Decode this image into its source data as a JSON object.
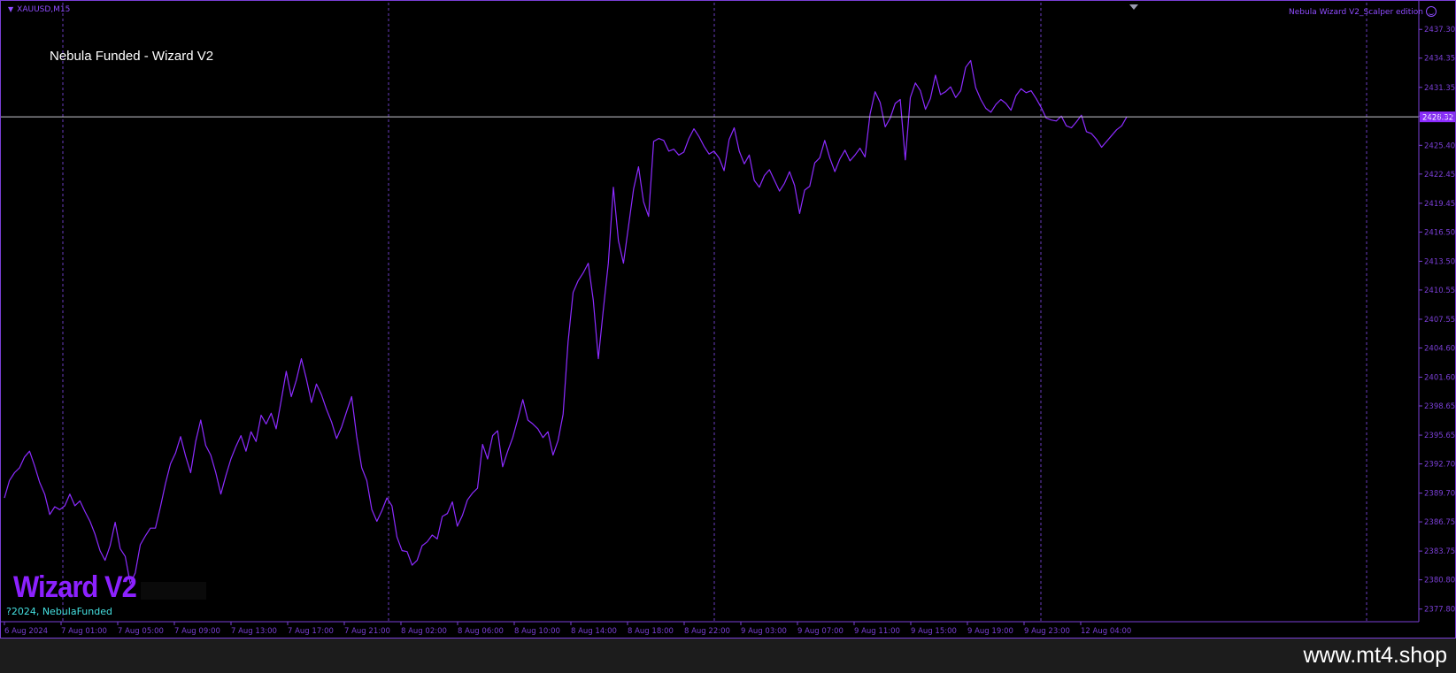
{
  "window": {
    "symbol": "XAUUSD,M15",
    "indicator_label": "Nebula Wizard V2_Scalper edition",
    "overlay_title": "Nebula Funded - Wizard V2",
    "logo_text": "Wizard V2",
    "copyright": "?2024, NebulaFunded",
    "current_price": "2428.32"
  },
  "watermark": "www.mt4.shop",
  "colors": {
    "background": "#000000",
    "line": "#8c2bff",
    "axis": "#7a3fd6",
    "separator": "#6a3bbf",
    "price_line": "#c8c8d0",
    "price_label_bg": "#8c2bff",
    "copyright": "#45e0e0"
  },
  "chart_data": {
    "type": "line",
    "symbol": "XAUUSD",
    "timeframe": "M15",
    "ylim": [
      2376.5,
      2439.5
    ],
    "y_ticks": [
      "2437.30",
      "2434.35",
      "2431.35",
      "2428.40",
      "2425.40",
      "2422.45",
      "2419.45",
      "2416.50",
      "2413.50",
      "2410.55",
      "2407.55",
      "2404.60",
      "2401.60",
      "2398.65",
      "2395.65",
      "2392.70",
      "2389.70",
      "2386.75",
      "2383.75",
      "2380.80",
      "2377.80"
    ],
    "x_ticks": [
      "6 Aug 2024",
      "7 Aug 01:00",
      "7 Aug 05:00",
      "7 Aug 09:00",
      "7 Aug 13:00",
      "7 Aug 17:00",
      "7 Aug 21:00",
      "8 Aug 02:00",
      "8 Aug 06:00",
      "8 Aug 10:00",
      "8 Aug 14:00",
      "8 Aug 18:00",
      "8 Aug 22:00",
      "9 Aug 03:00",
      "9 Aug 07:00",
      "9 Aug 11:00",
      "9 Aug 15:00",
      "9 Aug 19:00",
      "9 Aug 23:00",
      "12 Aug 04:00"
    ],
    "current_price": 2428.32,
    "series": [
      {
        "values": [
          2389.2,
          2391.0,
          2391.8,
          2392.3,
          2393.4,
          2394.0,
          2392.5,
          2390.8,
          2389.6,
          2387.5,
          2388.3,
          2388.0,
          2388.4,
          2389.6,
          2388.4,
          2388.9,
          2387.8,
          2386.8,
          2385.5,
          2383.8,
          2382.8,
          2384.3,
          2386.7,
          2384.0,
          2383.2,
          2380.4,
          2381.5,
          2384.4,
          2385.3,
          2386.1,
          2386.1,
          2388.3,
          2390.7,
          2392.7,
          2393.8,
          2395.5,
          2393.5,
          2391.8,
          2395.0,
          2397.2,
          2394.6,
          2393.6,
          2391.8,
          2389.6,
          2391.5,
          2393.2,
          2394.5,
          2395.6,
          2394.0,
          2396.0,
          2395.0,
          2397.7,
          2396.8,
          2397.9,
          2396.3,
          2399.2,
          2402.2,
          2399.6,
          2401.3,
          2403.5,
          2401.4,
          2399.0,
          2400.9,
          2399.8,
          2398.3,
          2397.0,
          2395.3,
          2396.5,
          2398.1,
          2399.6,
          2395.5,
          2392.3,
          2391.0,
          2388.0,
          2386.8,
          2387.9,
          2389.2,
          2388.4,
          2385.2,
          2383.8,
          2383.7,
          2382.3,
          2382.8,
          2384.3,
          2384.7,
          2385.4,
          2385.0,
          2387.3,
          2387.6,
          2388.8,
          2386.3,
          2387.4,
          2389.0,
          2389.7,
          2390.2,
          2394.7,
          2393.2,
          2395.6,
          2396.1,
          2392.4,
          2394.0,
          2395.4,
          2397.3,
          2399.3,
          2397.2,
          2396.8,
          2396.3,
          2395.4,
          2396.0,
          2393.6,
          2395.1,
          2397.8,
          2405.2,
          2410.3,
          2411.5,
          2412.3,
          2413.3,
          2409.5,
          2403.5,
          2408.5,
          2413.3,
          2421.1,
          2415.6,
          2413.3,
          2417.1,
          2420.9,
          2423.2,
          2419.6,
          2418.1,
          2425.8,
          2426.1,
          2425.9,
          2424.8,
          2425.0,
          2424.4,
          2424.7,
          2426.1,
          2427.1,
          2426.3,
          2425.3,
          2424.5,
          2424.8,
          2424.1,
          2422.8,
          2426.0,
          2427.2,
          2424.8,
          2423.5,
          2424.4,
          2421.8,
          2421.1,
          2422.3,
          2422.9,
          2421.8,
          2420.7,
          2421.5,
          2422.7,
          2421.3,
          2418.4,
          2420.8,
          2421.2,
          2423.6,
          2424.1,
          2425.9,
          2424.1,
          2422.7,
          2424.0,
          2424.9,
          2423.8,
          2424.4,
          2425.1,
          2424.2,
          2428.6,
          2430.9,
          2429.8,
          2427.3,
          2428.2,
          2429.7,
          2430.1,
          2423.9,
          2430.3,
          2431.8,
          2431.0,
          2429.1,
          2430.2,
          2432.6,
          2430.6,
          2430.9,
          2431.4,
          2430.3,
          2431.0,
          2433.4,
          2434.1,
          2431.3,
          2430.1,
          2429.2,
          2428.8,
          2429.6,
          2430.1,
          2429.7,
          2429.0,
          2430.5,
          2431.2,
          2430.8,
          2431.0,
          2430.2,
          2429.3,
          2428.2,
          2428.0,
          2427.9,
          2428.4,
          2427.4,
          2427.2,
          2427.8,
          2428.5,
          2426.8,
          2426.6,
          2426.0,
          2425.2,
          2425.8,
          2426.4,
          2427.0,
          2427.4,
          2428.32
        ]
      }
    ]
  }
}
